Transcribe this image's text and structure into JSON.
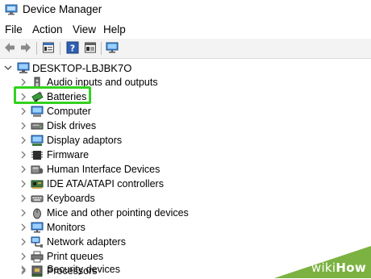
{
  "window": {
    "title": "Device Manager"
  },
  "menu": [
    "File",
    "Action",
    "View",
    "Help"
  ],
  "toolbar": {
    "icons": [
      "back-arrow-icon",
      "forward-arrow-icon",
      "properties-icon",
      "help-icon",
      "device-list-icon",
      "monitor-scan-icon"
    ]
  },
  "tree": {
    "root": "DESKTOP-LBJBK7O",
    "items": [
      {
        "label": "Audio inputs and outputs",
        "icon": "speaker-icon"
      },
      {
        "label": "Batteries",
        "icon": "battery-icon"
      },
      {
        "label": "Computer",
        "icon": "computer-icon"
      },
      {
        "label": "Disk drives",
        "icon": "disk-drive-icon"
      },
      {
        "label": "Display adaptors",
        "icon": "display-adapter-icon"
      },
      {
        "label": "Firmware",
        "icon": "firmware-chip-icon"
      },
      {
        "label": "Human Interface Devices",
        "icon": "hid-icon"
      },
      {
        "label": "IDE ATA/ATAPI controllers",
        "icon": "ide-controller-icon"
      },
      {
        "label": "Keyboards",
        "icon": "keyboard-icon"
      },
      {
        "label": "Mice and other pointing devices",
        "icon": "mouse-icon"
      },
      {
        "label": "Monitors",
        "icon": "monitor-icon"
      },
      {
        "label": "Network adapters",
        "icon": "network-adapter-icon"
      },
      {
        "label": "Print queues",
        "icon": "printer-icon"
      },
      {
        "label": "Processors",
        "icon": "processor-icon"
      },
      {
        "label": "Security devices",
        "icon": "security-device-icon"
      }
    ]
  },
  "highlight_color": "#33d11f",
  "watermark": {
    "wiki": "wiki",
    "how": "How"
  }
}
